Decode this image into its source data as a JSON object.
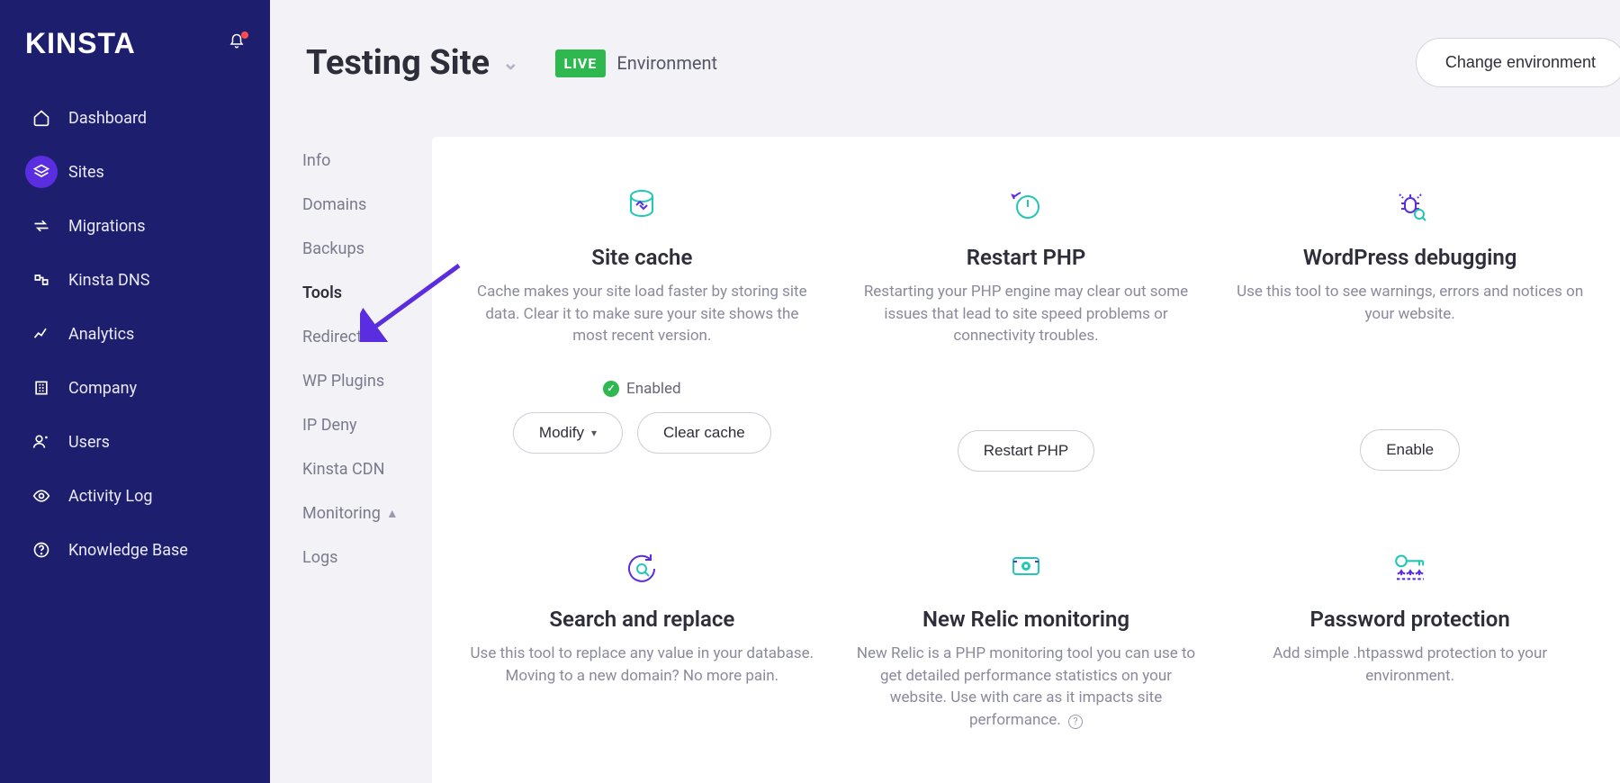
{
  "brand": "KINSTA",
  "header": {
    "site_title": "Testing Site",
    "live_badge": "LIVE",
    "env_label": "Environment",
    "change_env_label": "Change environment"
  },
  "sidebar": {
    "items": [
      {
        "label": "Dashboard"
      },
      {
        "label": "Sites"
      },
      {
        "label": "Migrations"
      },
      {
        "label": "Kinsta DNS"
      },
      {
        "label": "Analytics"
      },
      {
        "label": "Company"
      },
      {
        "label": "Users"
      },
      {
        "label": "Activity Log"
      },
      {
        "label": "Knowledge Base"
      }
    ]
  },
  "subnav": {
    "items": [
      {
        "label": "Info"
      },
      {
        "label": "Domains"
      },
      {
        "label": "Backups"
      },
      {
        "label": "Tools"
      },
      {
        "label": "Redirects"
      },
      {
        "label": "WP Plugins"
      },
      {
        "label": "IP Deny"
      },
      {
        "label": "Kinsta CDN"
      },
      {
        "label": "Monitoring"
      },
      {
        "label": "Logs"
      }
    ]
  },
  "tools": {
    "0": {
      "title": "Site cache",
      "desc": "Cache makes your site load faster by storing site data. Clear it to make sure your site shows the most recent version.",
      "status": "Enabled",
      "modify_label": "Modify",
      "clear_label": "Clear cache"
    },
    "1": {
      "title": "Restart PHP",
      "desc": "Restarting your PHP engine may clear out some issues that lead to site speed problems or connectivity troubles.",
      "action_label": "Restart PHP"
    },
    "2": {
      "title": "WordPress debugging",
      "desc": "Use this tool to see warnings, errors and notices on your website.",
      "action_label": "Enable"
    },
    "3": {
      "title": "Search and replace",
      "desc": "Use this tool to replace any value in your database. Moving to a new domain? No more pain."
    },
    "4": {
      "title": "New Relic monitoring",
      "desc": "New Relic is a PHP monitoring tool you can use to get detailed performance statistics on your website. Use with care as it impacts site performance."
    },
    "5": {
      "title": "Password protection",
      "desc": "Add simple .htpasswd protection to your environment."
    }
  }
}
